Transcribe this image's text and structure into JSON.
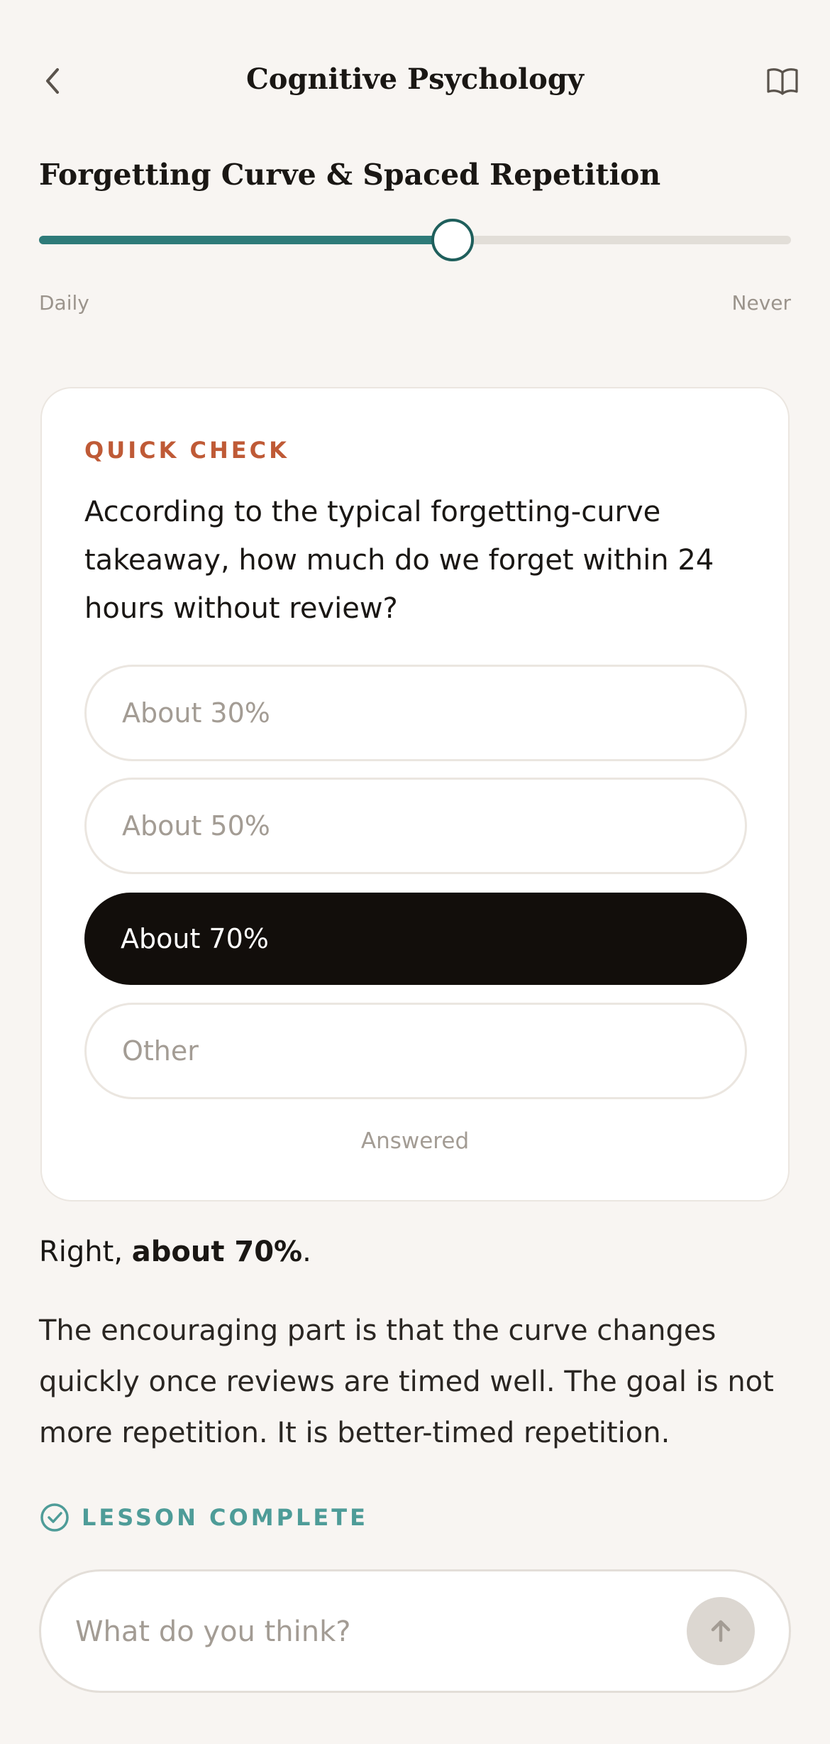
{
  "header": {
    "title": "Cognitive Psychology",
    "back_icon": "chevron-left-icon",
    "book_icon": "book-open-icon"
  },
  "lesson": {
    "title": "Forgetting Curve & Spaced Repetition"
  },
  "slider": {
    "min_label": "Daily",
    "max_label": "Never",
    "value_fraction": 0.55
  },
  "quiz": {
    "kicker": "QUICK CHECK",
    "question": "According to the typical forgetting-curve takeaway, how much do we forget within 24 hours without review?",
    "options": [
      {
        "label": "About 30%",
        "selected": false
      },
      {
        "label": "About 50%",
        "selected": false
      },
      {
        "label": "About 70%",
        "selected": true
      },
      {
        "label": "Other",
        "selected": false
      }
    ],
    "status": "Answered"
  },
  "response": {
    "prefix": "Right, ",
    "bold": "about 70%",
    "suffix": ".",
    "paragraph": "The encouraging part is that the curve changes quickly once reviews are timed well. The goal is not more repetition. It is better-timed repetition."
  },
  "completion": {
    "label": "LESSON COMPLETE",
    "icon": "check-circle-icon"
  },
  "composer": {
    "placeholder": "What do you think?",
    "send_icon": "arrow-up-icon"
  },
  "colors": {
    "accent_teal": "#2e7b79",
    "kicker_orange": "#bf5a36",
    "selected_option": "#120e0b",
    "background": "#f8f5f2"
  }
}
